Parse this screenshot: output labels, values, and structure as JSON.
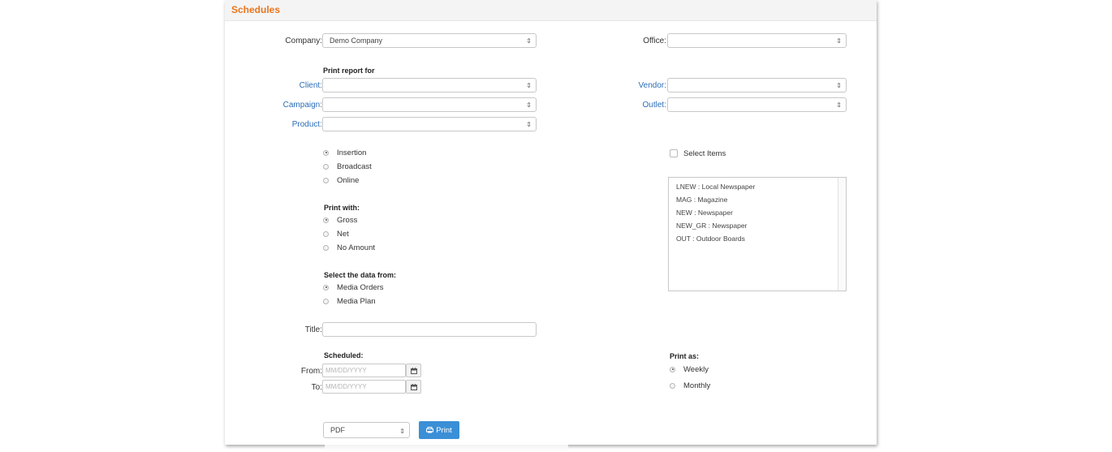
{
  "header": {
    "title": "Schedules"
  },
  "form": {
    "company_label": "Company:",
    "company_value": "Demo Company",
    "office_label": "Office:",
    "office_value": "",
    "print_report_for": "Print report for",
    "client_label": "Client:",
    "vendor_label": "Vendor:",
    "campaign_label": "Campaign:",
    "outlet_label": "Outlet:",
    "product_label": "Product:"
  },
  "report_type": {
    "options": [
      "Insertion",
      "Broadcast",
      "Online"
    ],
    "selected": "Insertion"
  },
  "select_items": {
    "label": "Select Items",
    "checked": false
  },
  "media_list": {
    "items": [
      "LNEW : Local Newspaper",
      "MAG : Magazine",
      "NEW : Newspaper",
      "NEW_GR : Newspaper",
      "OUT : Outdoor Boards"
    ]
  },
  "print_with": {
    "heading": "Print with:",
    "options": [
      "Gross",
      "Net",
      "No Amount"
    ],
    "selected": "Gross"
  },
  "data_source": {
    "heading": "Select the data from:",
    "options": [
      "Media Orders",
      "Media Plan"
    ],
    "selected": "Media Orders"
  },
  "title_field": {
    "label": "Title:",
    "value": ""
  },
  "scheduled": {
    "heading": "Scheduled:",
    "from_label": "From:",
    "to_label": "To:",
    "from_placeholder": "MM/DD/YYYY",
    "to_placeholder": "MM/DD/YYYY"
  },
  "print_as": {
    "heading": "Print as:",
    "options": [
      "Weekly",
      "Monthly"
    ],
    "selected": "Weekly"
  },
  "output": {
    "format_value": "PDF",
    "print_label": "Print"
  }
}
